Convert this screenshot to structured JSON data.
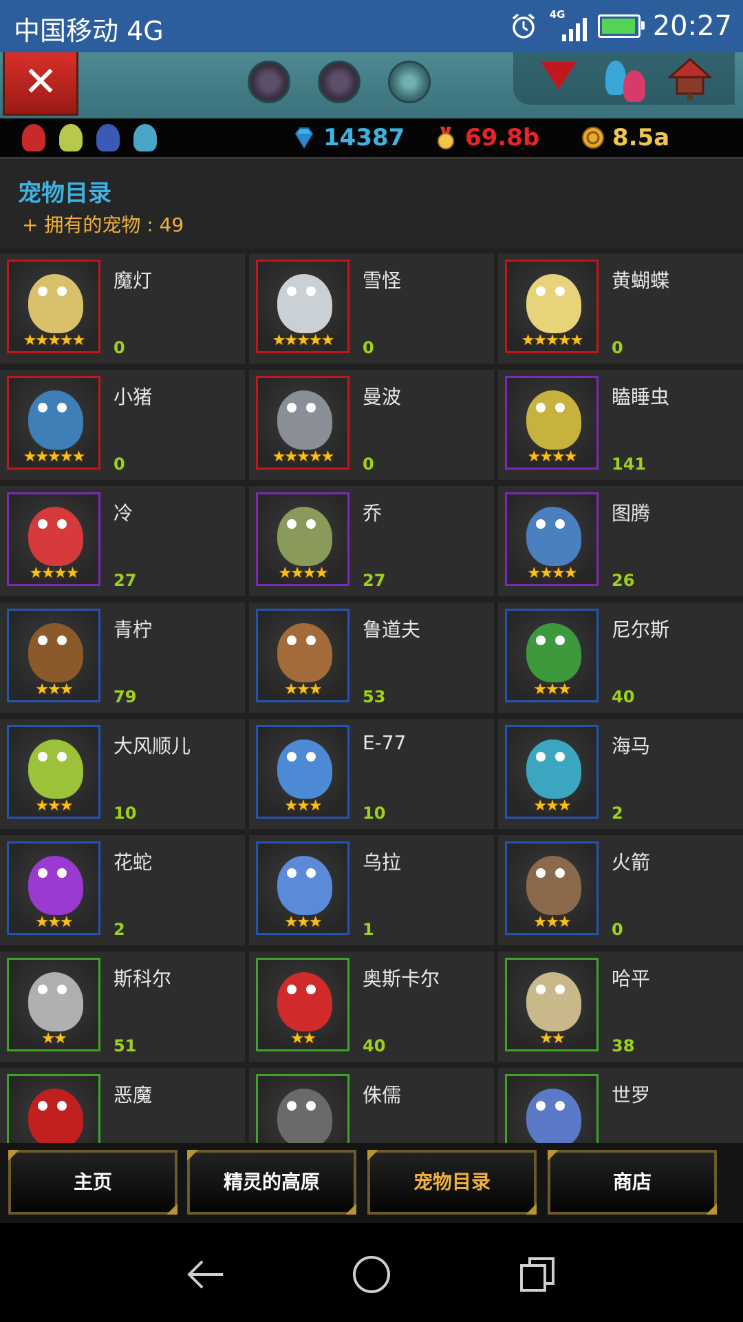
{
  "status_bar": {
    "carrier": "中国移动 4G",
    "network_label": "4G",
    "time": "20:27",
    "battery_level": 0.95
  },
  "currency": {
    "gems": "14387",
    "medals": "69.8b",
    "gold": "8.5a"
  },
  "header": {
    "title": "宠物目录",
    "owned_label": "+ 拥有的宠物 : 49"
  },
  "pets": [
    {
      "name": "魔灯",
      "count": "0",
      "stars": "★★★★★",
      "rarity": "red",
      "color": "#d9c06a"
    },
    {
      "name": "雪怪",
      "count": "0",
      "stars": "★★★★★",
      "rarity": "red",
      "color": "#c9d0d6"
    },
    {
      "name": "黄蝴蝶",
      "count": "0",
      "stars": "★★★★★",
      "rarity": "red",
      "color": "#e8d27a"
    },
    {
      "name": "小猪",
      "count": "0",
      "stars": "★★★★★",
      "rarity": "red",
      "color": "#3f7fb8"
    },
    {
      "name": "曼波",
      "count": "0",
      "stars": "★★★★★",
      "rarity": "red",
      "color": "#8a8e96"
    },
    {
      "name": "瞌睡虫",
      "count": "141",
      "stars": "★★★★",
      "rarity": "purple",
      "color": "#c8b23e"
    },
    {
      "name": "冷",
      "count": "27",
      "stars": "★★★★",
      "rarity": "purple",
      "color": "#d63a3a"
    },
    {
      "name": "乔",
      "count": "27",
      "stars": "★★★★",
      "rarity": "purple",
      "color": "#8a9a5a"
    },
    {
      "name": "图腾",
      "count": "26",
      "stars": "★★★★",
      "rarity": "purple",
      "color": "#4a7fc0"
    },
    {
      "name": "青柠",
      "count": "79",
      "stars": "★★★",
      "rarity": "blue",
      "color": "#8b5a2b"
    },
    {
      "name": "鲁道夫",
      "count": "53",
      "stars": "★★★",
      "rarity": "blue",
      "color": "#a36a3a"
    },
    {
      "name": "尼尔斯",
      "count": "40",
      "stars": "★★★",
      "rarity": "blue",
      "color": "#3c9a3c"
    },
    {
      "name": "大风顺儿",
      "count": "10",
      "stars": "★★★",
      "rarity": "blue",
      "color": "#9cc23a"
    },
    {
      "name": "E-77",
      "count": "10",
      "stars": "★★★",
      "rarity": "blue",
      "color": "#4d8ad6"
    },
    {
      "name": "海马",
      "count": "2",
      "stars": "★★★",
      "rarity": "blue",
      "color": "#3aa6c0"
    },
    {
      "name": "花蛇",
      "count": "2",
      "stars": "★★★",
      "rarity": "blue",
      "color": "#9a3ad0"
    },
    {
      "name": "乌拉",
      "count": "1",
      "stars": "★★★",
      "rarity": "blue",
      "color": "#5a8ad8"
    },
    {
      "name": "火箭",
      "count": "0",
      "stars": "★★★",
      "rarity": "blue",
      "color": "#8a6a4a"
    },
    {
      "name": "斯科尔",
      "count": "51",
      "stars": "★★",
      "rarity": "green",
      "color": "#b0b0b0"
    },
    {
      "name": "奥斯卡尔",
      "count": "40",
      "stars": "★★",
      "rarity": "green",
      "color": "#d02a2a"
    },
    {
      "name": "哈平",
      "count": "38",
      "stars": "★★",
      "rarity": "green",
      "color": "#c8b88a"
    },
    {
      "name": "恶魔",
      "count": "",
      "stars": "",
      "rarity": "green",
      "color": "#c02020"
    },
    {
      "name": "侏儒",
      "count": "",
      "stars": "",
      "rarity": "green",
      "color": "#6a6a6a"
    },
    {
      "name": "世罗",
      "count": "",
      "stars": "",
      "rarity": "green",
      "color": "#5a7ac8"
    }
  ],
  "bottom_nav": {
    "home": "主页",
    "plateau": "精灵的高原",
    "pets": "宠物目录",
    "shop": "商店"
  },
  "colors": {
    "title": "#3fb2e2",
    "owned": "#f0b13a",
    "count": "#9dd21a",
    "medal_value": "#e8242a",
    "gem_value": "#3fb2e2",
    "gold_value": "#f2c64a"
  }
}
